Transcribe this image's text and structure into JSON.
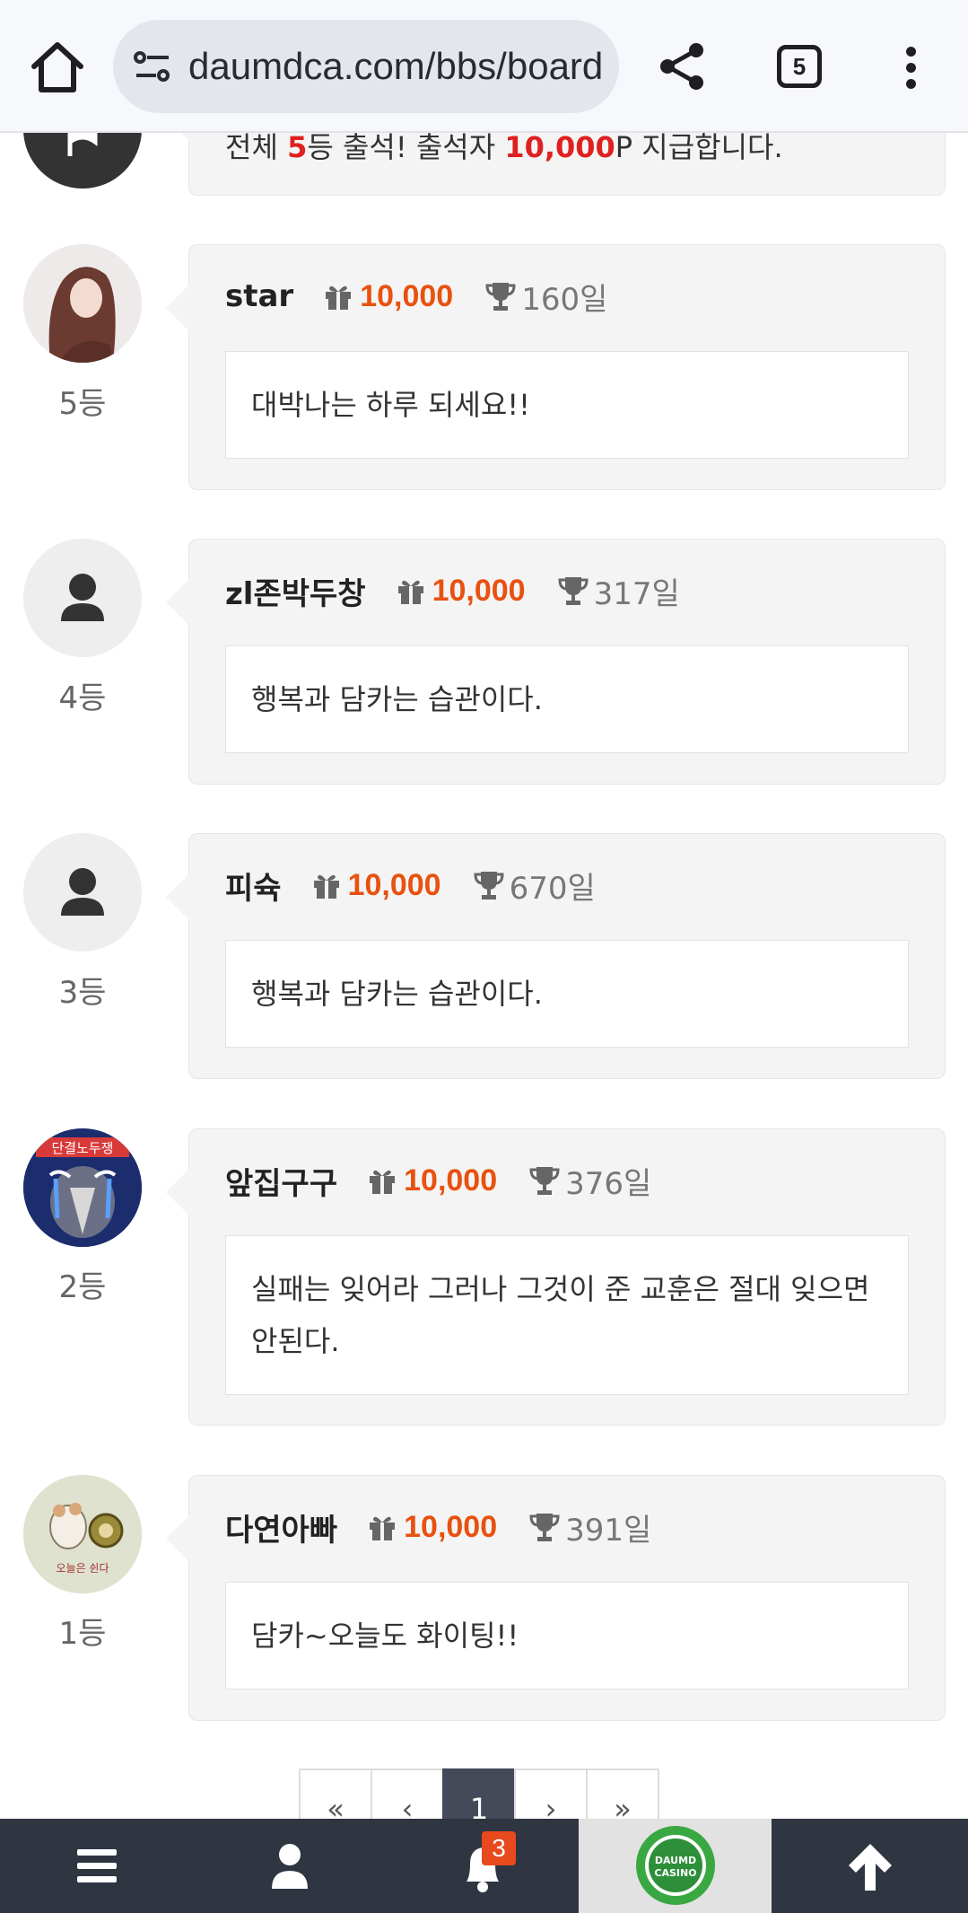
{
  "browser": {
    "url": "daumdca.com/bbs/board",
    "tab_count": "5"
  },
  "top_partial": {
    "text_before": "전체 ",
    "highlight_num": "5",
    "text_mid": "등 출석! 출석자 ",
    "highlight_points": "10,000",
    "text_after": "P 지급합니다."
  },
  "comments": [
    {
      "rank": "5등",
      "name": "star",
      "points": "10,000",
      "days": "160일",
      "message": "대박나는 하루 되세요!!",
      "avatar": "photo-woman"
    },
    {
      "rank": "4등",
      "name": "zl존박두창",
      "points": "10,000",
      "days": "317일",
      "message": "행복과 담카는 습관이다.",
      "avatar": "default-user"
    },
    {
      "rank": "3등",
      "name": "피슉",
      "points": "10,000",
      "days": "670일",
      "message": "행복과 담카는 습관이다.",
      "avatar": "default-user"
    },
    {
      "rank": "2등",
      "name": "앞집구구",
      "points": "10,000",
      "days": "376일",
      "message": "실패는 잊어라 그러나 그것이 준 교훈은 절대 잊으면 안된다.",
      "avatar": "bird-cartoon"
    },
    {
      "rank": "1등",
      "name": "다연아빠",
      "points": "10,000",
      "days": "391일",
      "message": "담카~오늘도 화이팅!!",
      "avatar": "hamster-cartoon"
    }
  ],
  "avatar_texts": {
    "bird_banner": "단결노두쟁",
    "hamster_caption": "오늘은 쉰다"
  },
  "pagination": {
    "first": "«",
    "prev": "‹",
    "current": "1",
    "next": "›",
    "last": "»"
  },
  "bottom_nav": {
    "notification_count": "3",
    "logo_text_1": "DAUMD",
    "logo_text_2": "CASINO"
  },
  "colors": {
    "points": "#e8510f",
    "highlight": "#e02020",
    "nav_bg": "#2f3642",
    "badge": "#e8491d"
  }
}
